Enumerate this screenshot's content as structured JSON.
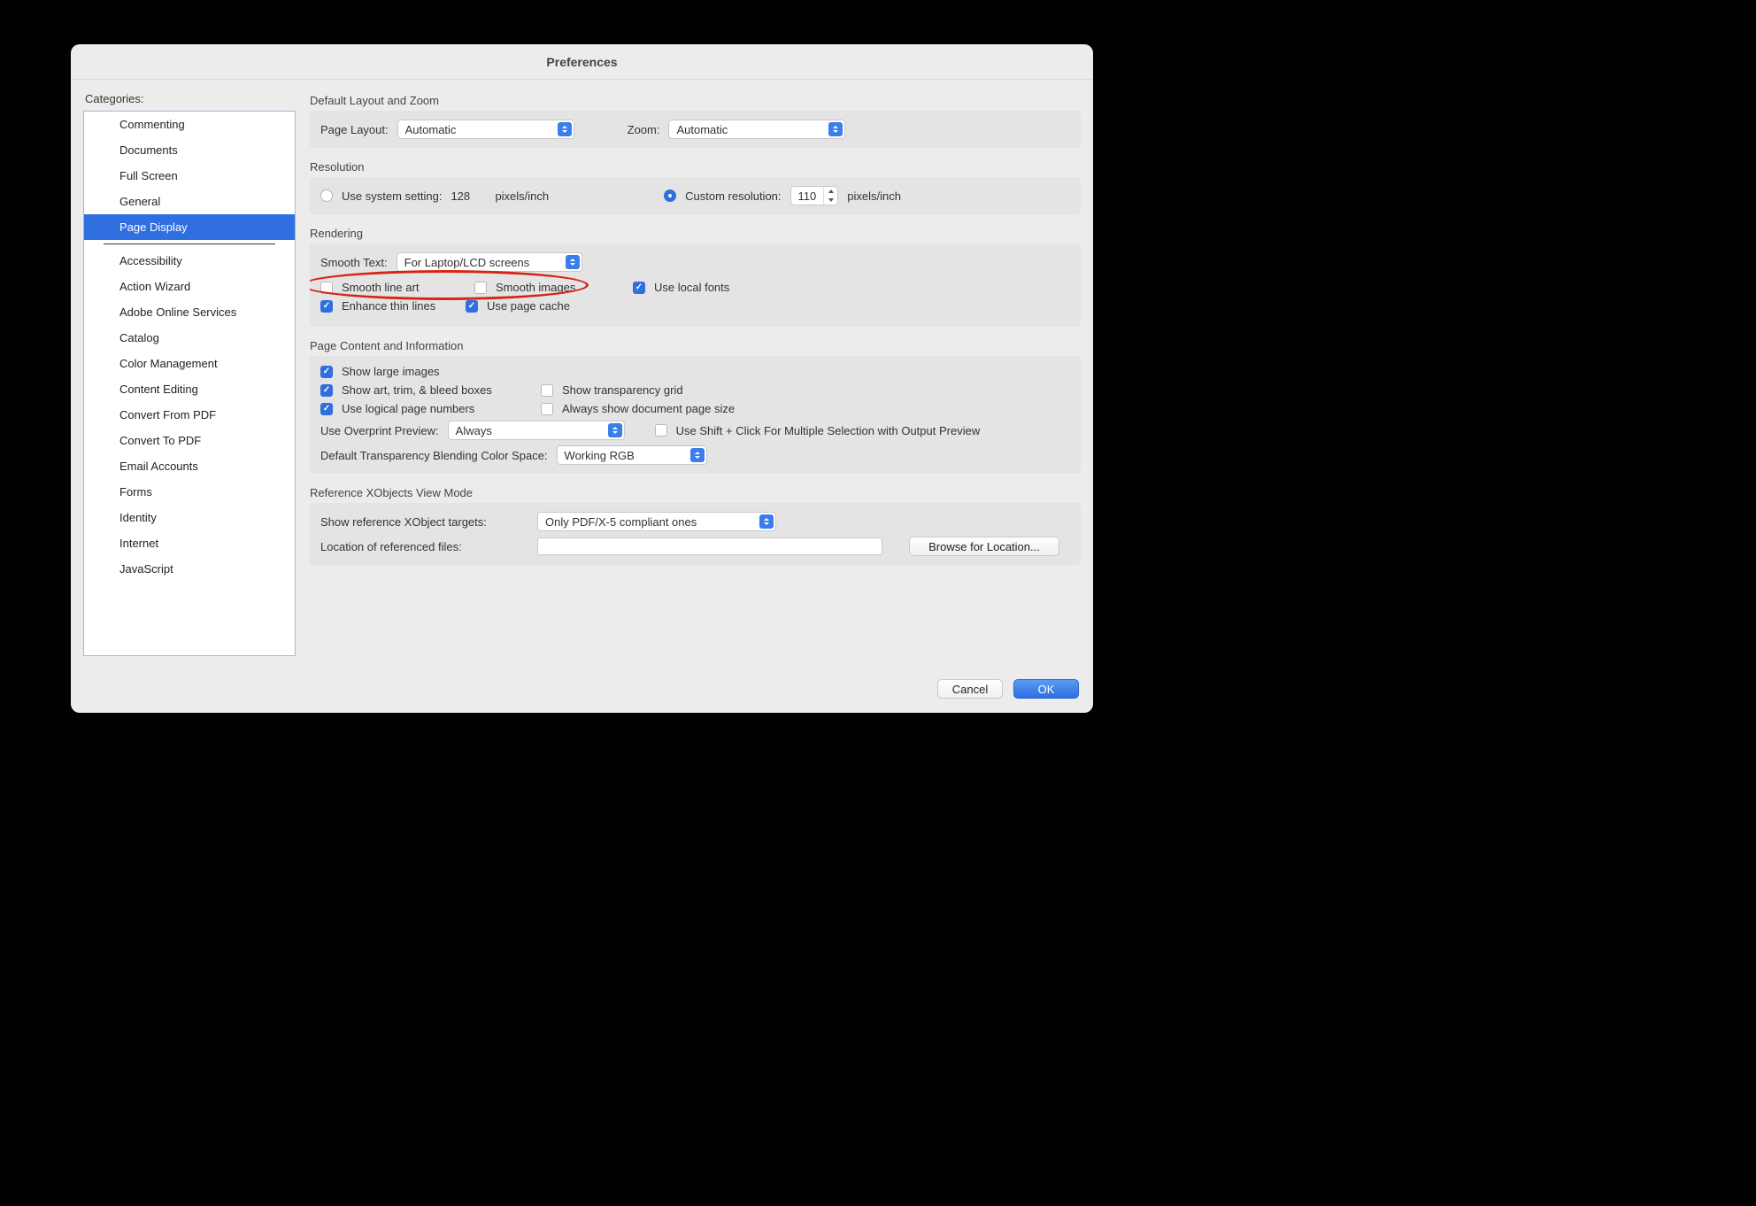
{
  "window": {
    "title": "Preferences"
  },
  "sidebar": {
    "label": "Categories:",
    "items_top": [
      "Commenting",
      "Documents",
      "Full Screen",
      "General",
      "Page Display"
    ],
    "selected": "Page Display",
    "items_bottom": [
      "Accessibility",
      "Action Wizard",
      "Adobe Online Services",
      "Catalog",
      "Color Management",
      "Content Editing",
      "Convert From PDF",
      "Convert To PDF",
      "Email Accounts",
      "Forms",
      "Identity",
      "Internet",
      "JavaScript"
    ]
  },
  "layout": {
    "title": "Default Layout and Zoom",
    "page_layout_label": "Page Layout:",
    "page_layout_value": "Automatic",
    "zoom_label": "Zoom:",
    "zoom_value": "Automatic"
  },
  "resolution": {
    "title": "Resolution",
    "system_label": "Use system setting:",
    "system_value": "128",
    "unit": "pixels/inch",
    "custom_label": "Custom resolution:",
    "custom_value": "110",
    "selected": "custom"
  },
  "rendering": {
    "title": "Rendering",
    "smooth_text_label": "Smooth Text:",
    "smooth_text_value": "For Laptop/LCD screens",
    "smooth_line_art": {
      "label": "Smooth line art",
      "checked": false
    },
    "smooth_images": {
      "label": "Smooth images",
      "checked": false
    },
    "use_local_fonts": {
      "label": "Use local fonts",
      "checked": true
    },
    "enhance_thin_lines": {
      "label": "Enhance thin lines",
      "checked": true
    },
    "use_page_cache": {
      "label": "Use page cache",
      "checked": true
    }
  },
  "page_content": {
    "title": "Page Content and Information",
    "show_large_images": {
      "label": "Show large images",
      "checked": true
    },
    "show_boxes": {
      "label": "Show art, trim, & bleed boxes",
      "checked": true
    },
    "show_transparency_grid": {
      "label": "Show transparency grid",
      "checked": false
    },
    "use_logical_pages": {
      "label": "Use logical page numbers",
      "checked": true
    },
    "always_show_size": {
      "label": "Always show document page size",
      "checked": false
    },
    "overprint_label": "Use Overprint Preview:",
    "overprint_value": "Always",
    "shift_click": {
      "label": "Use Shift + Click For Multiple Selection with Output Preview",
      "checked": false
    },
    "blending_label": "Default Transparency Blending Color Space:",
    "blending_value": "Working RGB"
  },
  "xobjects": {
    "title": "Reference XObjects View Mode",
    "targets_label": "Show reference XObject targets:",
    "targets_value": "Only PDF/X-5 compliant ones",
    "location_label": "Location of referenced files:",
    "location_value": "",
    "browse_label": "Browse for Location..."
  },
  "footer": {
    "cancel": "Cancel",
    "ok": "OK"
  }
}
